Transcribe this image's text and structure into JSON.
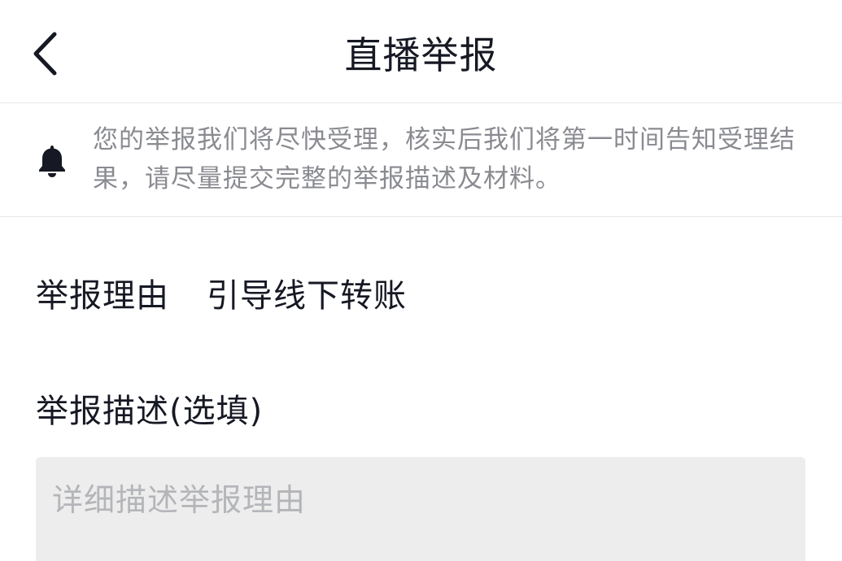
{
  "header": {
    "back_icon": "chevron-left-icon",
    "title": "直播举报"
  },
  "notice": {
    "icon": "bell-icon",
    "text": "您的举报我们将尽快受理，核实后我们将第一时间告知受理结果，请尽量提交完整的举报描述及材料。"
  },
  "reason": {
    "label": "举报理由",
    "value": "引导线下转账"
  },
  "description": {
    "label": "举报描述(选填)",
    "placeholder": "详细描述举报理由",
    "value": ""
  },
  "colors": {
    "text_primary": "#161823",
    "text_secondary": "#8a8b91",
    "input_bg": "#ededed",
    "divider": "#e6e6e8"
  }
}
